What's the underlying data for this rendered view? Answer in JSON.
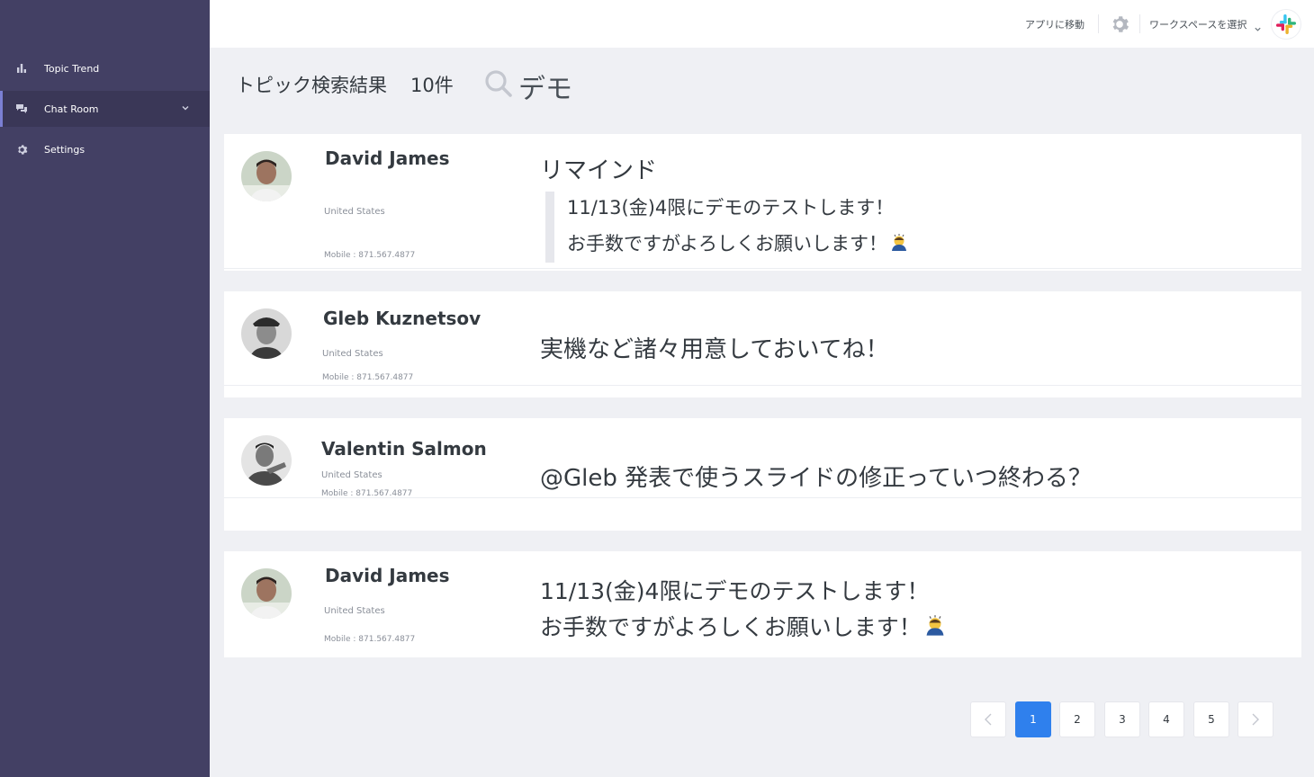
{
  "sidebar": {
    "items": [
      {
        "label": "Topic Trend",
        "icon": "bar-chart-icon"
      },
      {
        "label": "Chat Room",
        "icon": "chat-bubbles-icon",
        "active": true
      },
      {
        "label": "Settings",
        "icon": "gear-icon"
      }
    ]
  },
  "topbar": {
    "go_to_app": "アプリに移動",
    "workspace_select": "ワークスペースを選択"
  },
  "header": {
    "title": "トピック検索結果",
    "count": "10件",
    "query": "デモ"
  },
  "results": [
    {
      "name": "David James",
      "country": "United States",
      "mobile": "Mobile : 871.567.4877",
      "message_title": "リマインド",
      "quote": [
        "11/13(金)4限にデモのテストします！",
        "お手数ですがよろしくお願いします！"
      ]
    },
    {
      "name": "Gleb Kuznetsov",
      "country": "United States",
      "mobile": "Mobile : 871.567.4877",
      "message": "実機など諸々用意しておいてね！"
    },
    {
      "name": "Valentin Salmon",
      "country": "United States",
      "mobile": "Mobile : 871.567.4877",
      "message": "@Gleb 発表で使うスライドの修正っていつ終わる？"
    },
    {
      "name": "David James",
      "country": "United States",
      "mobile": "Mobile : 871.567.4877",
      "message_lines": [
        "11/13(金)4限にデモのテストします！",
        "お手数ですがよろしくお願いします！"
      ]
    }
  ],
  "pagination": {
    "pages": [
      "1",
      "2",
      "3",
      "4",
      "5"
    ],
    "current": "1"
  },
  "colors": {
    "sidebar": "#434064",
    "accent": "#2f80ed",
    "background": "#eff0f4"
  }
}
